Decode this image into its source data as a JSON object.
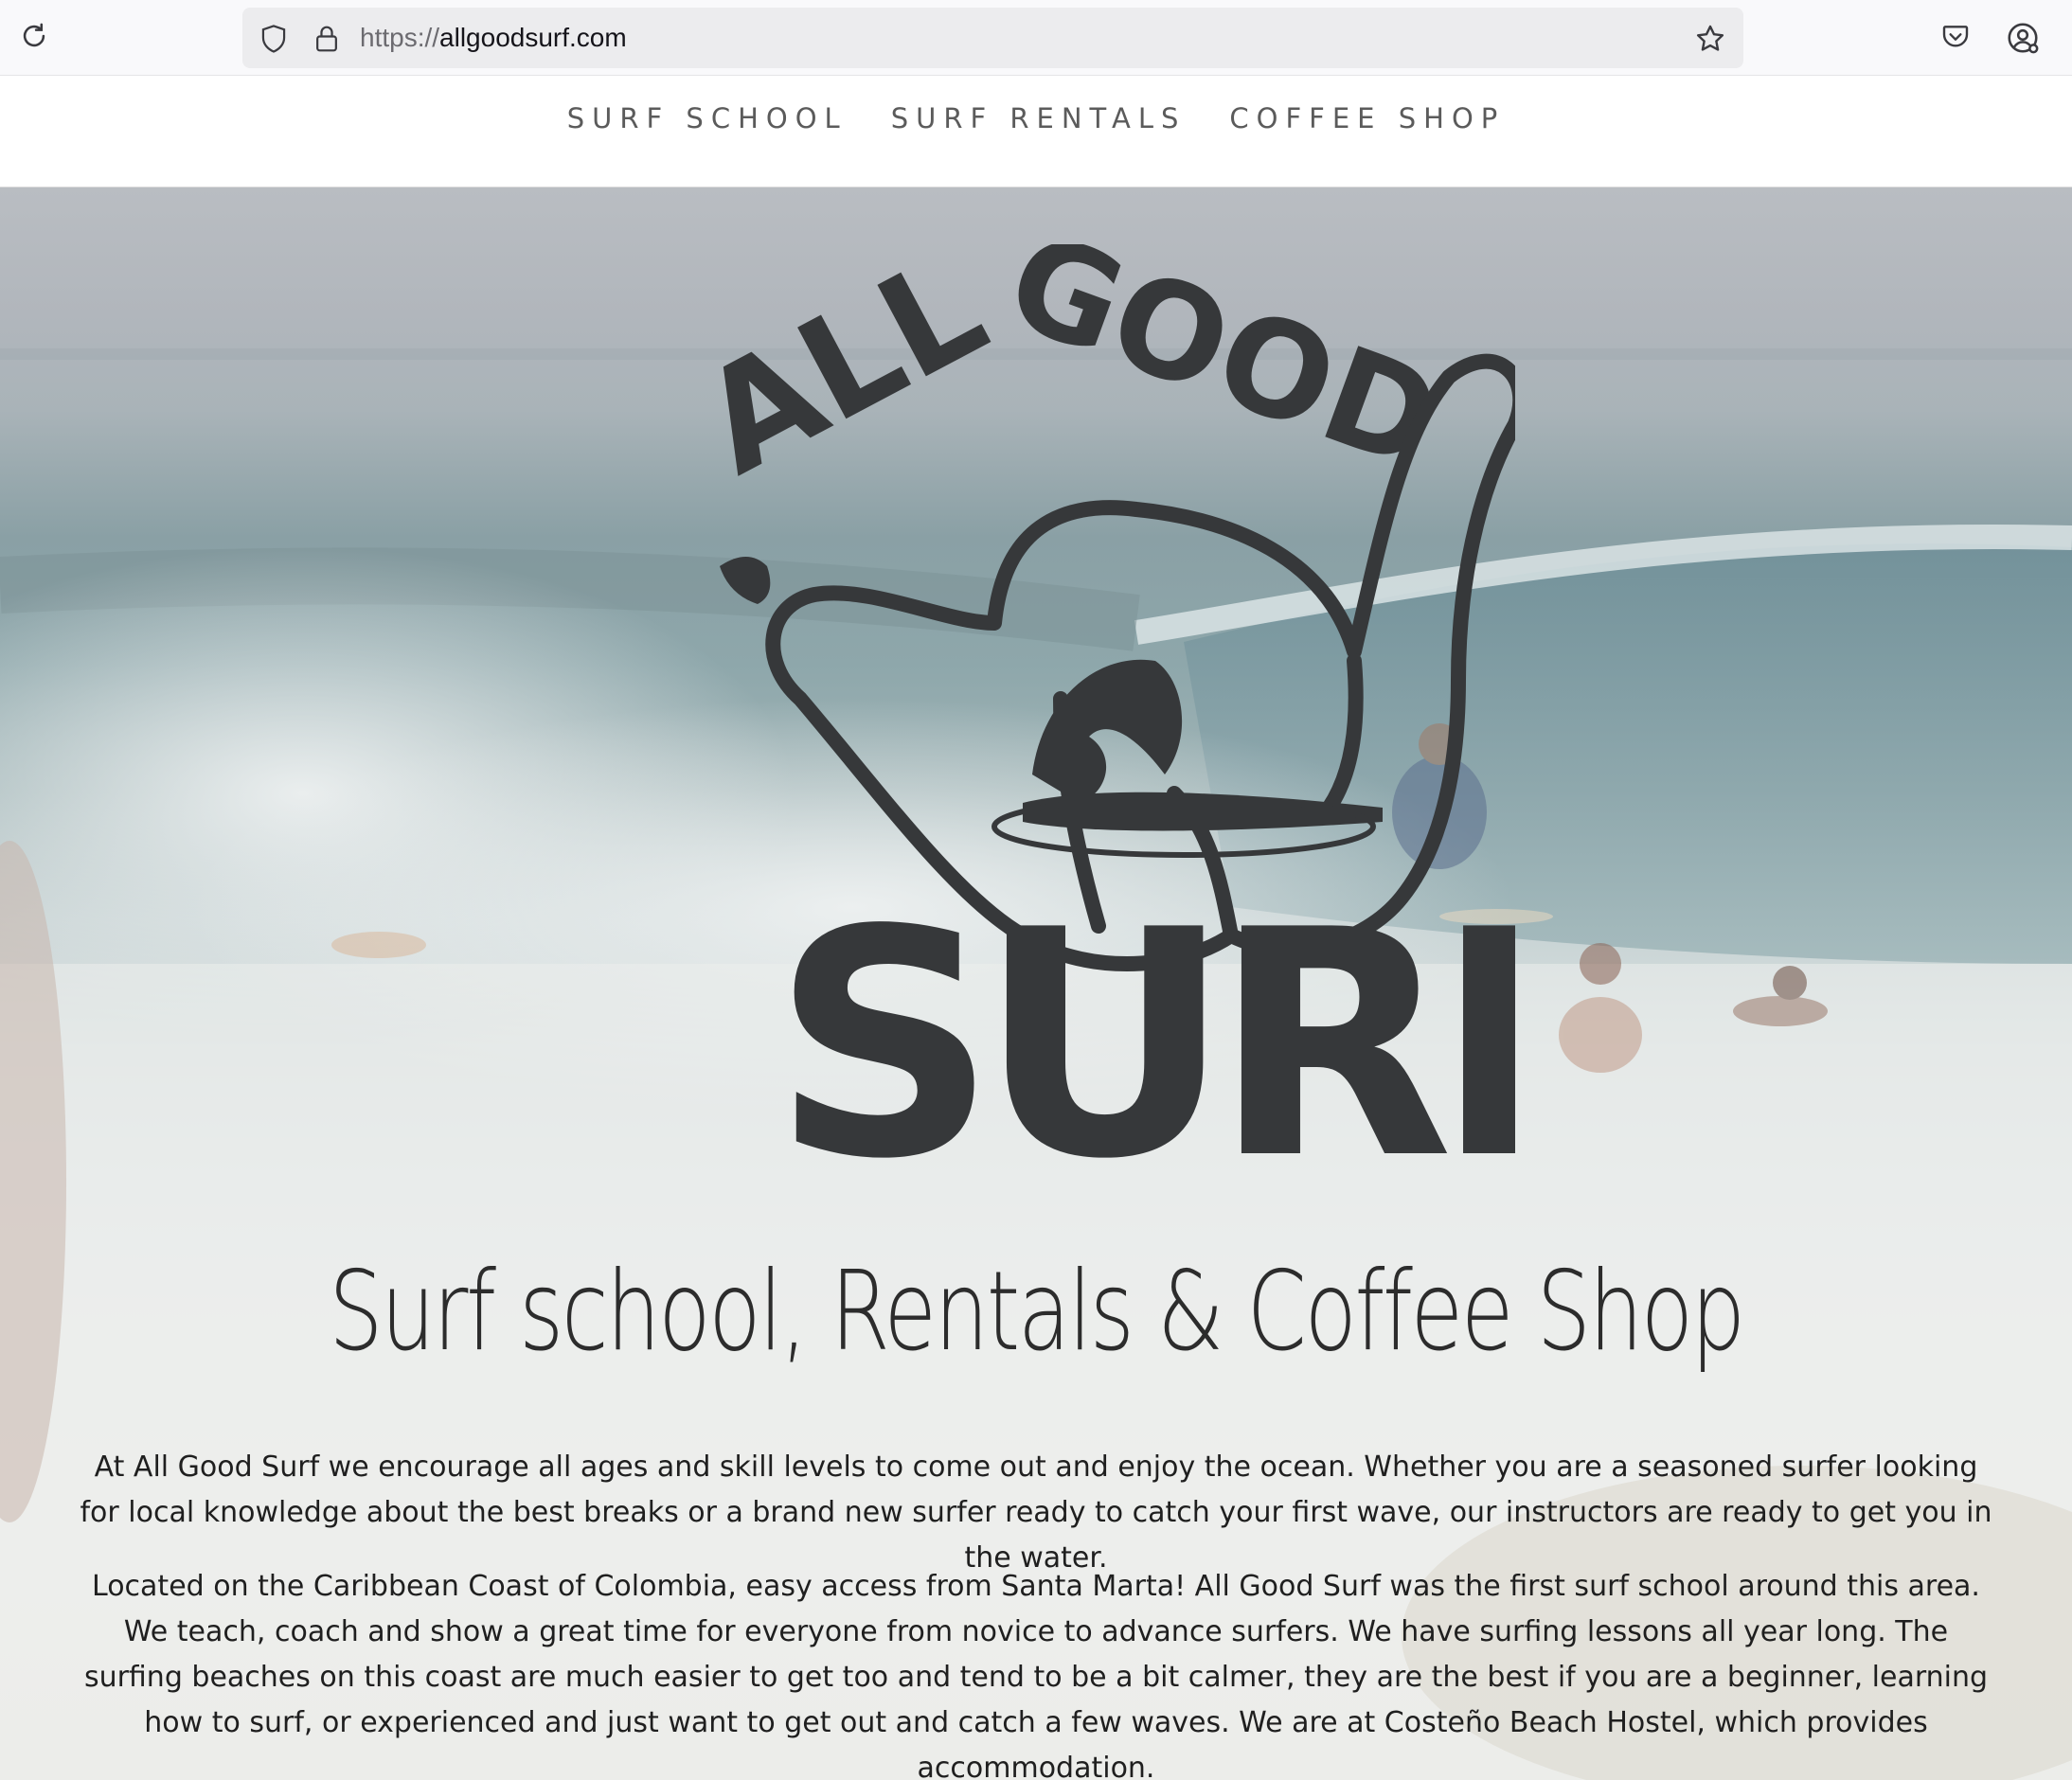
{
  "browser": {
    "url_scheme": "https://",
    "url_host": "allgoodsurf.com",
    "icons": [
      "reload-icon",
      "shield-icon",
      "lock-icon",
      "star-icon",
      "pocket-icon",
      "account-icon"
    ]
  },
  "nav": {
    "items": [
      {
        "label": "SURF SCHOOL"
      },
      {
        "label": "SURF RENTALS"
      },
      {
        "label": "COFFEE SHOP"
      }
    ]
  },
  "hero": {
    "logo_text": "ALL GOOD SURF",
    "title": "Surf school, Rentals & Coffee Shop",
    "paragraphs": [
      "At All Good Surf we encourage all ages and skill levels to come out and enjoy the ocean. Whether you are a seasoned surfer looking for local knowledge about the best breaks or a brand new surfer ready to catch your first wave, our instructors are ready to get you in the water.",
      "Located on the Caribbean Coast of Colombia, easy access from Santa Marta! All Good Surf was the first surf school around this area. We teach, coach and show a great time for everyone from novice to advance surfers. We have surfing lessons all year long. The surfing beaches on this coast are much easier to get too and tend to be a bit calmer, they are the best if you are a beginner, learning how to surf, or experienced and just want to get out and catch a few waves. We are at Costeño Beach Hostel, which provides accommodation."
    ]
  },
  "colors": {
    "logo_ink": "#36383a",
    "nav_text": "#5b5b5b",
    "chrome_bg": "#f9f9fb",
    "url_bar_bg": "#ececee"
  }
}
